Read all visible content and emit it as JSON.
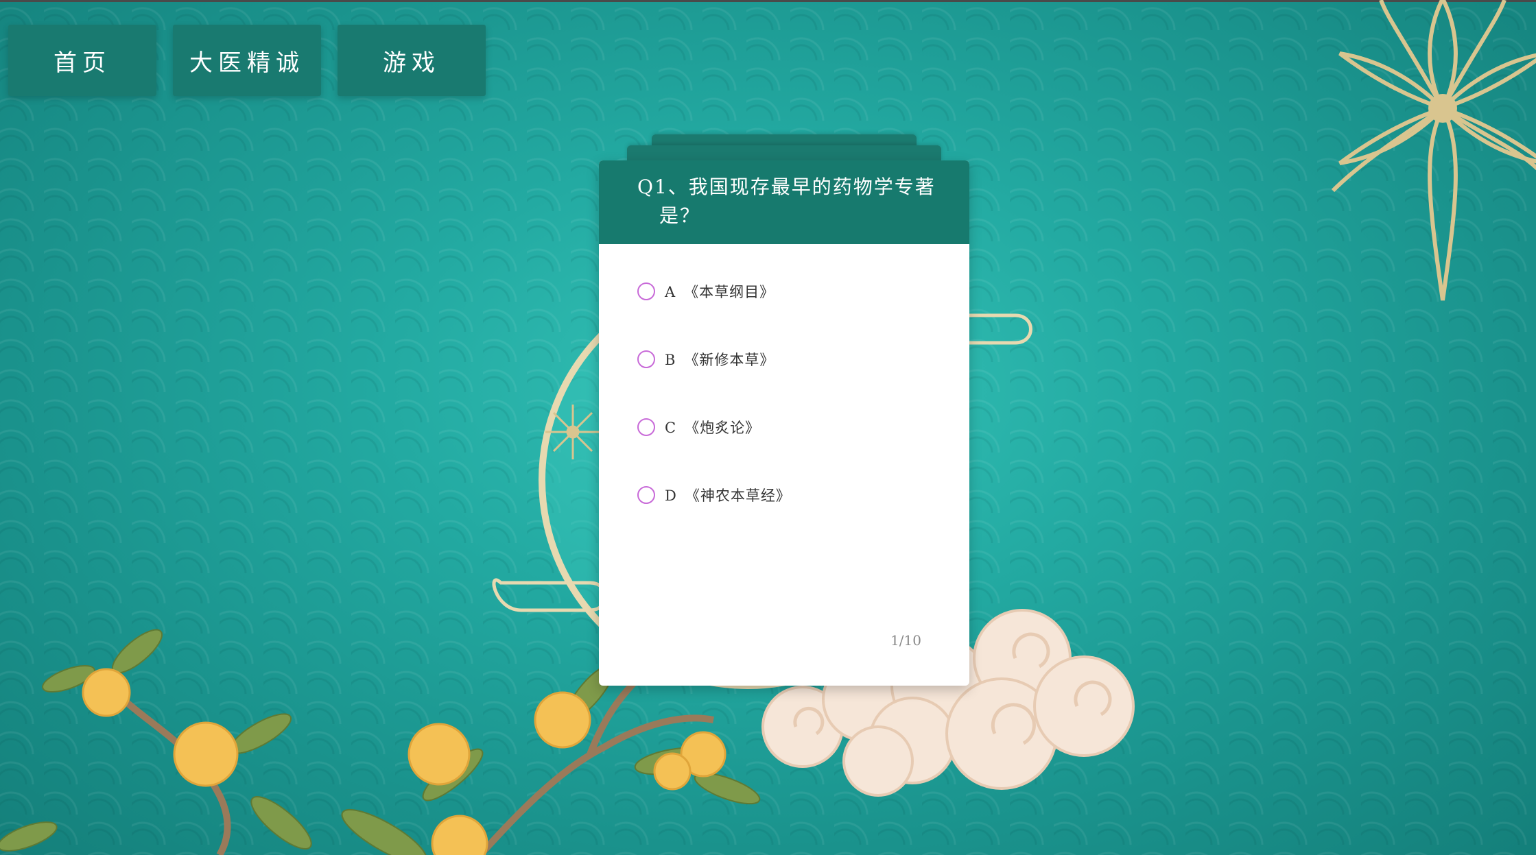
{
  "nav": {
    "items": [
      {
        "label": "首页"
      },
      {
        "label": "大医精诚"
      },
      {
        "label": "游戏"
      }
    ]
  },
  "quiz": {
    "question": "Q1、我国现存最早的药物学专著是？",
    "question_line1": "Q1、我国现存最早的药物学专著",
    "question_line2": "是？",
    "options": [
      {
        "letter": "A",
        "text": "《本草纲目》"
      },
      {
        "letter": "B",
        "text": "《新修本草》"
      },
      {
        "letter": "C",
        "text": "《炮炙论》"
      },
      {
        "letter": "D",
        "text": "《神农本草经》"
      }
    ],
    "progress": "1/10"
  },
  "colors": {
    "accent": "#177a6e",
    "background": "#23aaa2",
    "radio": "#c86ad8",
    "gold": "#d8c48e"
  }
}
